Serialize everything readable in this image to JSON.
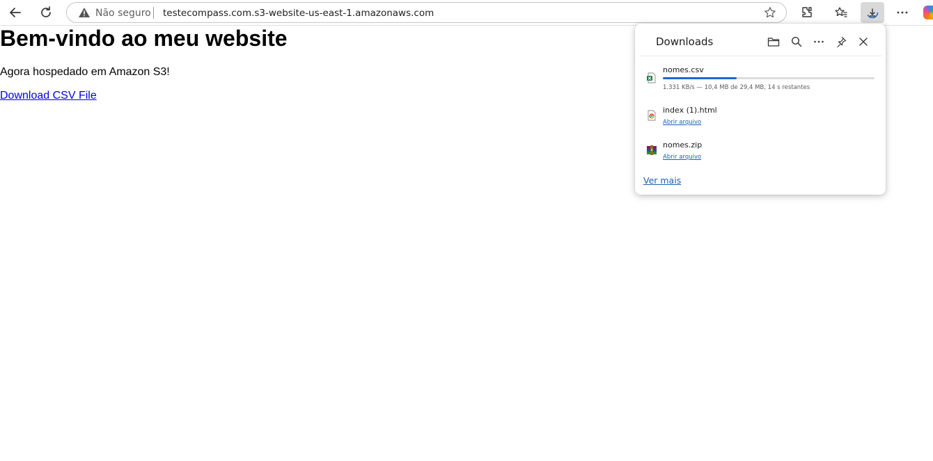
{
  "browser": {
    "security_label": "Não seguro",
    "url": "testecompass.com.s3-website-us-east-1.amazonaws.com",
    "icons": [
      "back-arrow-icon",
      "refresh-icon",
      "warning-icon",
      "favorite-star-icon",
      "extensions-icon",
      "favorites-icon",
      "downloads-icon",
      "more-options-icon",
      "copilot-icon"
    ]
  },
  "page": {
    "title": "Bem-vindo ao meu website",
    "subtitle": "Agora hospedado em Amazon S3!",
    "download_link": "Download CSV File"
  },
  "downloads": {
    "title": "Downloads",
    "header_icons": [
      "folder-icon",
      "search-icon",
      "more-icon",
      "pin-icon",
      "close-icon"
    ],
    "items": [
      {
        "name": "nomes.csv",
        "icon": "excel-file-icon",
        "progress": 0.35,
        "status": "1.331 KB/s — 10,4 MB de 29,4 MB, 14 s restantes"
      },
      {
        "name": "index (1).html",
        "icon": "html-file-icon",
        "action": "Abrir arquivo"
      },
      {
        "name": "nomes.zip",
        "icon": "zip-archive-icon",
        "action": "Abrir arquivo"
      }
    ],
    "see_more": "Ver mais",
    "accent_color": "#1e66d0"
  }
}
